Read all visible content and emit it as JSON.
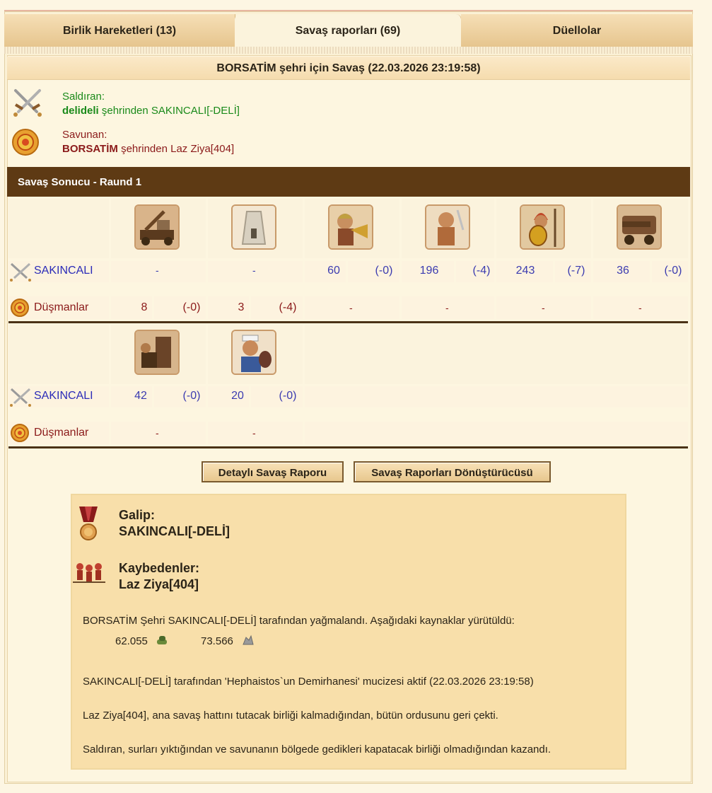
{
  "tabs": [
    {
      "label": "Birlik Hareketleri (13)"
    },
    {
      "label": "Savaş raporları (69)"
    },
    {
      "label": "Düellolar"
    }
  ],
  "report_title": "BORSATİM şehri için Savaş (22.03.2026 23:19:58)",
  "attacker": {
    "label": "Saldıran:",
    "city": "delideli",
    "rest": "şehrinden SAKINCALI[-DELİ]"
  },
  "defender": {
    "label": "Savunan:",
    "city": "BORSATİM",
    "rest": "şehrinden Laz Ziya[404]"
  },
  "result_header": "Savaş Sonucu - Raund 1",
  "row_labels": {
    "attacker": "SAKINCALI",
    "enemies": "Düşmanlar"
  },
  "table1": {
    "attacker": [
      {
        "value": "-",
        "loss": ""
      },
      {
        "value": "-",
        "loss": ""
      },
      {
        "value": "60",
        "loss": "(-0)"
      },
      {
        "value": "196",
        "loss": "(-4)"
      },
      {
        "value": "243",
        "loss": "(-7)"
      },
      {
        "value": "36",
        "loss": "(-0)"
      }
    ],
    "enemies": [
      {
        "value": "8",
        "loss": "(-0)"
      },
      {
        "value": "3",
        "loss": "(-4)"
      },
      {
        "value": "-",
        "loss": ""
      },
      {
        "value": "-",
        "loss": ""
      },
      {
        "value": "-",
        "loss": ""
      },
      {
        "value": "-",
        "loss": ""
      }
    ]
  },
  "table2": {
    "attacker": [
      {
        "value": "42",
        "loss": "(-0)"
      },
      {
        "value": "20",
        "loss": "(-0)"
      }
    ],
    "enemies": [
      {
        "value": "-",
        "loss": ""
      },
      {
        "value": "-",
        "loss": ""
      }
    ]
  },
  "buttons": {
    "detailed": "Detaylı Savaş Raporu",
    "converter": "Savaş Raporları Dönüştürücüsü"
  },
  "summary": {
    "winner_label": "Galip:",
    "winner": "SAKINCALI[-DELİ]",
    "losers_label": "Kaybedenler:",
    "losers": "Laz Ziya[404]",
    "plunder_text": "BORSATİM Şehri SAKINCALI[-DELİ] tarafından yağmalandı. Aşağıdaki kaynaklar yürütüldü:",
    "resource_wood": "62.055",
    "resource_stone": "73.566",
    "wonder_text": "SAKINCALI[-DELİ] tarafından 'Hephaistos`un Demirhanesi' mucizesi aktif (22.03.2026 23:19:58)",
    "retreat_text": "Laz Ziya[404], ana savaş hattını tutacak birliği kalmadığından, bütün ordusunu geri çekti.",
    "victory_text": "Saldıran, surları yıktığından ve savunanın bölgede gedikleri kapatacak birliği olmadığından kazandı."
  },
  "colors": {
    "header_brown": "#5e3a14",
    "attacker_green": "#1a8a1a",
    "defender_red": "#8b1a1a",
    "value_blue": "#3b3bb0"
  }
}
